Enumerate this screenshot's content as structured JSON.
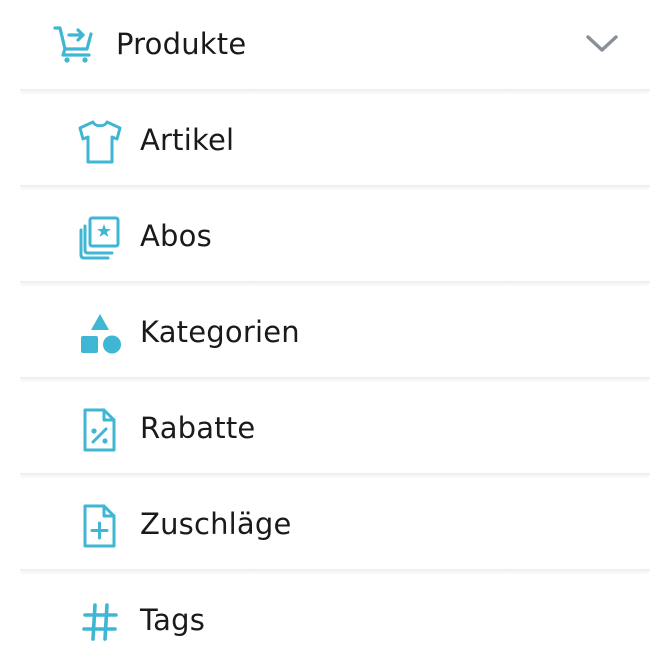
{
  "colors": {
    "icon": "#3fb6d3",
    "chevron": "#8a8f99",
    "text": "#1a1a1a",
    "separator": "#eceef4"
  },
  "menu": {
    "header": {
      "label": "Produkte",
      "icon": "cart-arrow-icon",
      "expanded": true
    },
    "items": [
      {
        "label": "Artikel",
        "icon": "tshirt-icon"
      },
      {
        "label": "Abos",
        "icon": "photo-star-icon"
      },
      {
        "label": "Kategorien",
        "icon": "shapes-icon"
      },
      {
        "label": "Rabatte",
        "icon": "percent-document-icon"
      },
      {
        "label": "Zuschläge",
        "icon": "plus-document-icon"
      },
      {
        "label": "Tags",
        "icon": "hash-icon"
      }
    ]
  }
}
